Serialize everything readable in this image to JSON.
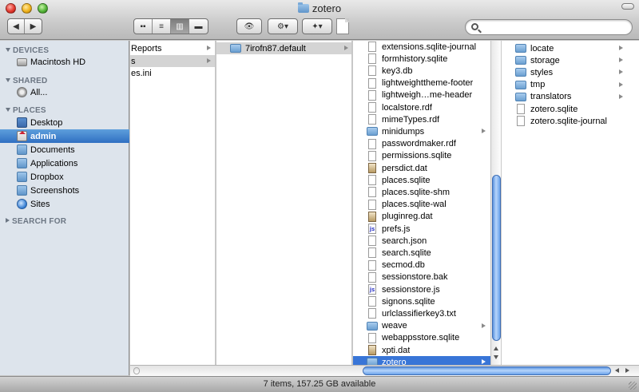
{
  "window": {
    "title": "zotero"
  },
  "toolbar": {
    "back_icon": "◀",
    "forward_icon": "▶",
    "view_icons": [
      "▪▪",
      "≡",
      "▥",
      "▬"
    ],
    "quicklook_icon": "👁",
    "action_icon": "⚙▾",
    "dropbox_icon": "✦▾",
    "search_placeholder": ""
  },
  "sidebar": {
    "devices_header": "DEVICES",
    "devices": [
      {
        "label": "Macintosh HD",
        "icon": "hard-drive-icon"
      }
    ],
    "shared_header": "SHARED",
    "shared": [
      {
        "label": "All...",
        "icon": "network-icon"
      }
    ],
    "places_header": "PLACES",
    "places": [
      {
        "label": "Desktop",
        "icon": "desktop-icon"
      },
      {
        "label": "admin",
        "icon": "home-icon",
        "selected": true
      },
      {
        "label": "Documents",
        "icon": "documents-icon"
      },
      {
        "label": "Applications",
        "icon": "applications-icon"
      },
      {
        "label": "Dropbox",
        "icon": "dropbox-folder-icon"
      },
      {
        "label": "Screenshots",
        "icon": "folder-icon"
      },
      {
        "label": "Sites",
        "icon": "sites-icon"
      }
    ],
    "search_header": "SEARCH FOR"
  },
  "columns": {
    "col1": [
      "Reports",
      "s",
      "es.ini"
    ],
    "col2": [
      "7irofn87.default"
    ],
    "col3": [
      {
        "name": "extensions.sqlite-journal",
        "type": "file"
      },
      {
        "name": "formhistory.sqlite",
        "type": "file"
      },
      {
        "name": "key3.db",
        "type": "file"
      },
      {
        "name": "lightweighttheme-footer",
        "type": "file"
      },
      {
        "name": "lightweigh…me-header",
        "type": "file"
      },
      {
        "name": "localstore.rdf",
        "type": "file"
      },
      {
        "name": "mimeTypes.rdf",
        "type": "file"
      },
      {
        "name": "minidumps",
        "type": "folder"
      },
      {
        "name": "passwordmaker.rdf",
        "type": "file"
      },
      {
        "name": "permissions.sqlite",
        "type": "file"
      },
      {
        "name": "persdict.dat",
        "type": "dat"
      },
      {
        "name": "places.sqlite",
        "type": "file"
      },
      {
        "name": "places.sqlite-shm",
        "type": "file"
      },
      {
        "name": "places.sqlite-wal",
        "type": "file"
      },
      {
        "name": "pluginreg.dat",
        "type": "dat"
      },
      {
        "name": "prefs.js",
        "type": "js"
      },
      {
        "name": "search.json",
        "type": "file"
      },
      {
        "name": "search.sqlite",
        "type": "file"
      },
      {
        "name": "secmod.db",
        "type": "file"
      },
      {
        "name": "sessionstore.bak",
        "type": "file"
      },
      {
        "name": "sessionstore.js",
        "type": "js"
      },
      {
        "name": "signons.sqlite",
        "type": "file"
      },
      {
        "name": "urlclassifierkey3.txt",
        "type": "file"
      },
      {
        "name": "weave",
        "type": "folder"
      },
      {
        "name": "webappsstore.sqlite",
        "type": "file"
      },
      {
        "name": "xpti.dat",
        "type": "dat"
      },
      {
        "name": "zotero",
        "type": "folder",
        "selected": true
      }
    ],
    "col4": [
      {
        "name": "locate",
        "type": "folder"
      },
      {
        "name": "storage",
        "type": "folder"
      },
      {
        "name": "styles",
        "type": "folder"
      },
      {
        "name": "tmp",
        "type": "folder"
      },
      {
        "name": "translators",
        "type": "folder"
      },
      {
        "name": "zotero.sqlite",
        "type": "file"
      },
      {
        "name": "zotero.sqlite-journal",
        "type": "file"
      }
    ]
  },
  "status": {
    "text": "7 items, 157.25 GB available"
  },
  "colors": {
    "selection": "#3875d7",
    "sidebar_bg": "#dde4ec",
    "sidebar_selection": "#2f6fc2"
  }
}
